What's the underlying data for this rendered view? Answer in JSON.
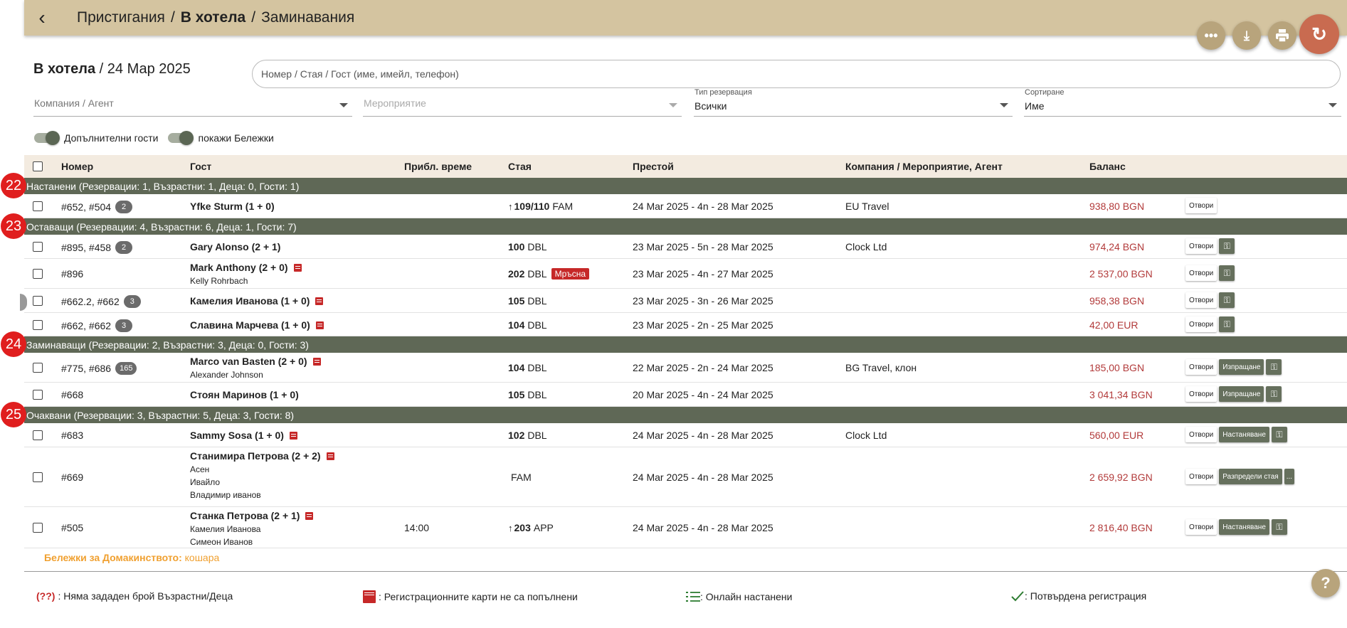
{
  "breadcrumb": {
    "item1": "Пристигания",
    "sep": "/",
    "current": "В хотела",
    "item3": "Заминавания"
  },
  "page": {
    "title_bold": "В хотела",
    "title_rest": " / 24 Мар 2025"
  },
  "search": {
    "placeholder": "Номер / Стая / Гост (име, имейл, телефон)"
  },
  "filters": {
    "company": {
      "placeholder": "Компания / Агент"
    },
    "event": {
      "placeholder": "Мероприятие"
    },
    "res_type": {
      "label": "Тип резервация",
      "value": "Всички"
    },
    "sort": {
      "label": "Сортиране",
      "value": "Име"
    }
  },
  "toggles": {
    "extra_guests": "Допълнителни гости",
    "show_notes": "покажи Бележки"
  },
  "columns": [
    "Номер",
    "Гост",
    "Прибл. време",
    "Стая",
    "Престой",
    "Компания / Мероприятие, Агент",
    "Баланс"
  ],
  "groups": [
    {
      "badge": "22",
      "label": "Настанени (Резервации: 1, Възрастни: 1, Деца: 0, Гости: 1)",
      "rows": [
        {
          "num": "#652, #504",
          "cnt": "2",
          "guest": "Yfke Sturm (1 + 0)",
          "subs": [],
          "eta": "",
          "room_num": "109/110",
          "room_type": "FAM",
          "stay": "24 Mar 2025 - 4n - 28 Mar 2025",
          "comp": "EU Travel",
          "bal": "938,80 BGN"
        }
      ]
    },
    {
      "badge": "23",
      "label": "Оставащи (Резервации: 4, Възрастни: 6, Деца: 1, Гости: 7)",
      "rows": [
        {
          "num": "#895, #458",
          "cnt": "2",
          "guest": "Gary Alonso (2 + 1)",
          "subs": [],
          "eta": "",
          "room_num": "100",
          "room_type": "DBL",
          "stay": "23 Mar 2025 - 5n - 28 Mar 2025",
          "comp": "Clock Ltd",
          "bal": "974,24 BGN"
        },
        {
          "num": "#896",
          "cnt": "",
          "guest": "Mark Anthony (2 + 0)",
          "subs": [
            "Kelly Rohrbach"
          ],
          "eta": "",
          "room_num": "202",
          "room_type": "DBL",
          "dirty": "Мръсна",
          "stay": "23 Mar 2025 - 4n - 27 Mar 2025",
          "comp": "",
          "bal": "2 537,00 BGN"
        },
        {
          "num": "#662.2, #662",
          "cnt": "3",
          "guest": "Камелия Иванова (1 + 0)",
          "subs": [],
          "eta": "",
          "room_num": "105",
          "room_type": "DBL",
          "stay": "23 Mar 2025 - 3n - 26 Mar 2025",
          "comp": "",
          "bal": "958,38 BGN"
        },
        {
          "num": "#662, #662",
          "cnt": "3",
          "guest": "Славина Марчева (1 + 0)",
          "subs": [],
          "eta": "",
          "room_num": "104",
          "room_type": "DBL",
          "stay": "23 Mar 2025 - 2n - 25 Mar 2025",
          "comp": "",
          "bal": "42,00 EUR"
        }
      ]
    },
    {
      "badge": "24",
      "label": "Заминаващи (Резервации: 2, Възрастни: 3, Деца: 0, Гости: 3)",
      "rows": [
        {
          "num": "#775, #686",
          "cnt": "165",
          "guest": "Marco van Basten (2 + 0)",
          "subs": [
            "Alexander Johnson"
          ],
          "eta": "",
          "room_num": "104",
          "room_type": "DBL",
          "stay": "22 Mar 2025 - 2n - 24 Mar 2025",
          "comp": "BG Travel, клон",
          "bal": "185,00 BGN"
        },
        {
          "num": "#668",
          "cnt": "",
          "guest": "Стоян Маринов (1 + 0)",
          "subs": [],
          "eta": "",
          "room_num": "105",
          "room_type": "DBL",
          "stay": "20 Mar 2025 - 4n - 24 Mar 2025",
          "comp": "",
          "bal": "3 041,34 BGN"
        }
      ]
    },
    {
      "badge": "25",
      "label": "Очаквани (Резервации: 3, Възрастни: 5, Деца: 3, Гости: 8)",
      "rows": [
        {
          "num": "#683",
          "cnt": "",
          "guest": "Sammy Sosa (1 + 0)",
          "subs": [],
          "eta": "",
          "room_num": "102",
          "room_type": "DBL",
          "stay": "24 Mar 2025 - 4n - 28 Mar 2025",
          "comp": "Clock Ltd",
          "bal": "560,00 EUR"
        },
        {
          "num": "#669",
          "cnt": "",
          "guest": "Станимира Петрова (2 + 2)",
          "subs": [
            "Асен",
            "Ивайло",
            "Владимир иванов"
          ],
          "eta": "",
          "room_num": "",
          "room_type": "FAM",
          "stay": "24 Mar 2025 - 4n - 28 Mar 2025",
          "comp": "",
          "bal": "2 659,92 BGN"
        },
        {
          "num": "#505",
          "cnt": "",
          "guest": "Станка Петрова (2 + 1)",
          "subs": [
            "Камелия Иванова",
            "Симеон Иванов"
          ],
          "eta": "14:00",
          "room_num": "203",
          "room_type": "APP",
          "stay": "24 Mar 2025 - 4n - 28 Mar 2025",
          "comp": "",
          "bal": "2 816,40 BGN"
        }
      ]
    }
  ],
  "buttons": {
    "open": "Отвори",
    "checkout": "Изпращане",
    "checkin": "Настаняване",
    "assign": "Разпредели стая",
    "more": "..."
  },
  "notes": {
    "label": "Бележки за Домакинството:",
    "value": " кошара"
  },
  "legend": {
    "q_mark": "(??)",
    "q_text": " : Няма зададен брой Възрастни/Деца",
    "reg_text": " : Регистрационните карти не са попълнени",
    "online_text": " : Онлайн настанени",
    "confirmed_text": " : Потвърдена регистрация"
  },
  "colors": {
    "topbar": "#d4c4a0",
    "group_row": "#5f6856",
    "balance": "#b23a3a",
    "badge": "#e01e1e",
    "accent": "#c96b50"
  }
}
